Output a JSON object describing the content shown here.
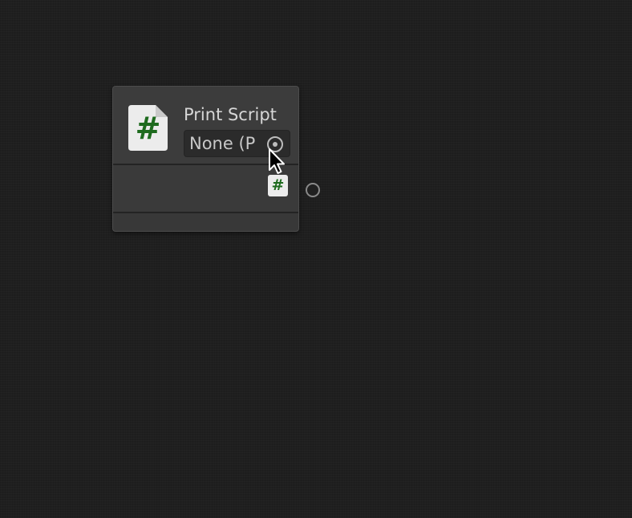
{
  "node": {
    "title": "Print Script",
    "icon": "csharp-script-icon",
    "icon_glyph": "#",
    "object_field": {
      "value": "None (P",
      "picker_icon": "object-picker-icon"
    },
    "output_port": {
      "type_icon": "csharp-script-icon",
      "type_glyph": "#"
    }
  },
  "colors": {
    "canvas_background": "#1f1f1f",
    "node_background": "#393939",
    "script_icon_green": "#1e6b1e",
    "text": "#d6d6d6"
  },
  "cursor": {
    "icon": "arrow-cursor-icon"
  }
}
